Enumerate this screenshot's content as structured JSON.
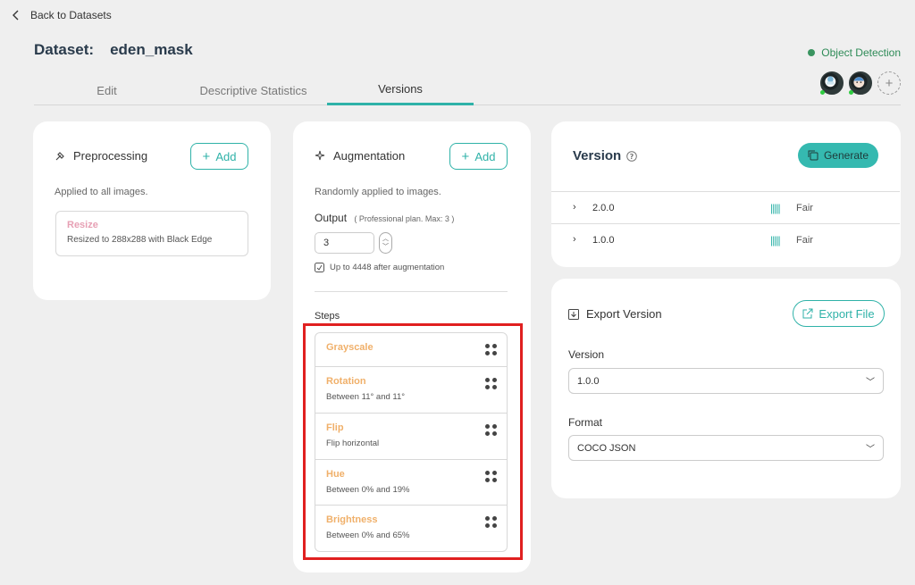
{
  "nav": {
    "back_label": "Back to Datasets"
  },
  "header": {
    "dataset_prefix": "Dataset:",
    "dataset_name": "eden_mask",
    "project_type": "Object Detection"
  },
  "tabs": [
    "Edit",
    "Descriptive Statistics",
    "Versions"
  ],
  "active_tab": "Versions",
  "preprocessing": {
    "title": "Preprocessing",
    "add_label": "Add",
    "subtitle": "Applied to all images.",
    "items": [
      {
        "name": "Resize",
        "desc": "Resized to 288x288 with Black Edge"
      }
    ]
  },
  "augmentation": {
    "title": "Augmentation",
    "add_label": "Add",
    "subtitle": "Randomly applied to images.",
    "output_label": "Output",
    "output_hint": "( Professional plan. Max: 3 )",
    "output_value": "3",
    "after_note": "Up to 4448 after augmentation",
    "steps_label": "Steps",
    "steps": [
      {
        "name": "Grayscale",
        "desc": ""
      },
      {
        "name": "Rotation",
        "desc": "Between 11° and 11°"
      },
      {
        "name": "Flip",
        "desc": "Flip horizontal"
      },
      {
        "name": "Hue",
        "desc": "Between 0% and 19%"
      },
      {
        "name": "Brightness",
        "desc": "Between 0% and 65%"
      }
    ]
  },
  "versions": {
    "title": "Version",
    "generate_label": "Generate",
    "rows": [
      {
        "version": "2.0.0",
        "quality": "Fair"
      },
      {
        "version": "1.0.0",
        "quality": "Fair"
      }
    ]
  },
  "export": {
    "title": "Export Version",
    "export_label": "Export File",
    "version_label": "Version",
    "version_value": "1.0.0",
    "format_label": "Format",
    "format_value": "COCO JSON"
  },
  "colors": {
    "accent": "#2fb2a8",
    "highlight": "#e02020",
    "step_name": "#f0b06a",
    "preproc_name": "#e7a0b4"
  }
}
